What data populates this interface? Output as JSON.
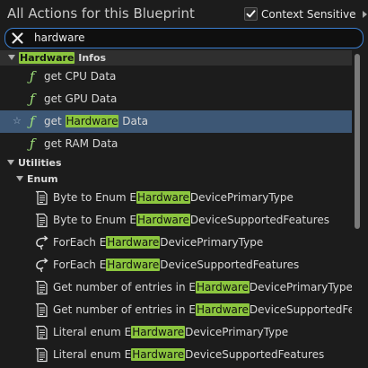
{
  "header": {
    "title": "All Actions for this Blueprint",
    "context_label": "Context Sensitive",
    "context_checked": true
  },
  "search": {
    "value": "hardware"
  },
  "sections": {
    "hardware_infos": {
      "pre": "",
      "hl": "Hardware",
      "post": " Infos"
    },
    "utilities": {
      "label": "Utilities"
    },
    "enum": {
      "label": "Enum"
    }
  },
  "items": [
    {
      "icon": "function-icon",
      "pre": "get CPU Data",
      "hl": "",
      "post": ""
    },
    {
      "icon": "function-icon",
      "pre": "get GPU Data",
      "hl": "",
      "post": ""
    },
    {
      "icon": "function-icon",
      "pre": "get ",
      "hl": "Hardware",
      "post": " Data",
      "selected": true
    },
    {
      "icon": "function-icon",
      "pre": "get RAM Data",
      "hl": "",
      "post": ""
    },
    {
      "icon": "document-icon",
      "pre": "Byte to Enum E",
      "hl": "Hardware",
      "post": "DevicePrimaryType"
    },
    {
      "icon": "document-icon",
      "pre": "Byte to Enum E",
      "hl": "Hardware",
      "post": "DeviceSupportedFeatures"
    },
    {
      "icon": "loop-icon",
      "pre": "ForEach E",
      "hl": "Hardware",
      "post": "DevicePrimaryType"
    },
    {
      "icon": "loop-icon",
      "pre": "ForEach E",
      "hl": "Hardware",
      "post": "DeviceSupportedFeatures"
    },
    {
      "icon": "document-icon",
      "pre": "Get number of entries in E",
      "hl": "Hardware",
      "post": "DevicePrimaryType"
    },
    {
      "icon": "document-icon",
      "pre": "Get number of entries in E",
      "hl": "Hardware",
      "post": "DeviceSupportedFeat"
    },
    {
      "icon": "document-icon",
      "pre": "Literal enum E",
      "hl": "Hardware",
      "post": "DevicePrimaryType"
    },
    {
      "icon": "document-icon",
      "pre": "Literal enum E",
      "hl": "Hardware",
      "post": "DeviceSupportedFeatures"
    }
  ]
}
